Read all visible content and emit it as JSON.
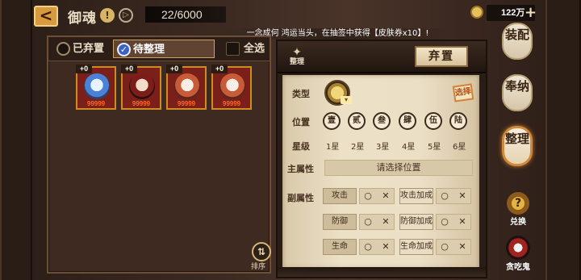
{
  "header": {
    "back_label": "<",
    "title": "御魂",
    "info_icon": "!",
    "play_icon": "▷",
    "count": "22/6000",
    "currency": "122万",
    "plus": "+"
  },
  "banner": "一念成何 鸿运当头，在抽签中获得【皮肤券x10】!",
  "tabs": {
    "discarded": "已弃置",
    "pending": "待整理",
    "pending_check": "✓",
    "select_all": "全选"
  },
  "cards": [
    {
      "level": "+0",
      "stars": "99999",
      "style": "blue"
    },
    {
      "level": "+0",
      "stars": "99999",
      "style": "red"
    },
    {
      "level": "+0",
      "stars": "99999",
      "style": "white"
    },
    {
      "level": "+0",
      "stars": "99999",
      "style": "white"
    }
  ],
  "sort": {
    "icon": "⇅",
    "label": "排序"
  },
  "panel": {
    "settle_icon": "✦",
    "settle_label": "整理",
    "discard": "弃置",
    "type_label": "类型",
    "type_chevron": "▾",
    "filter": "选择",
    "position_label": "位置",
    "positions": [
      "壹",
      "贰",
      "叁",
      "肆",
      "伍",
      "陆"
    ],
    "star_label": "星级",
    "stars": [
      "1星",
      "2星",
      "3星",
      "4星",
      "5星",
      "6星"
    ],
    "main_label": "主属性",
    "main_placeholder": "请选择位置",
    "sub_label": "副属性",
    "sub_rows": [
      {
        "a": "攻击",
        "b": "攻击加成"
      },
      {
        "a": "防御",
        "b": "防御加成"
      },
      {
        "a": "生命",
        "b": "生命加成"
      }
    ],
    "circle": "○",
    "cross": "✕"
  },
  "right_menu": {
    "equip": "装配",
    "enhance": "奉纳",
    "settle": "整理",
    "redeem": "兑换",
    "redeem_icon": "?",
    "gluttony": "贪吃鬼"
  }
}
